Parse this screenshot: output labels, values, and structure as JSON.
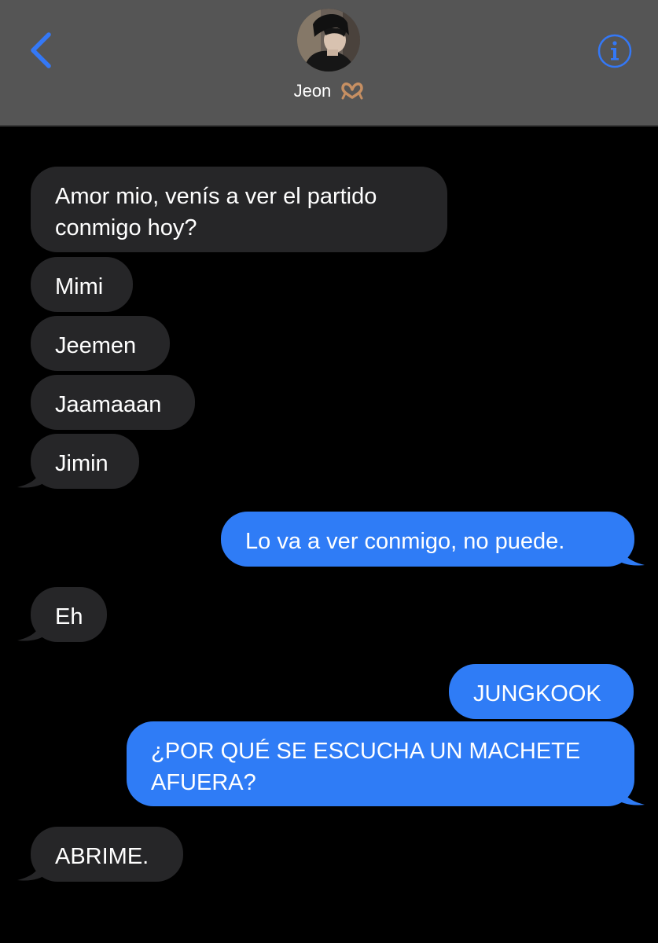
{
  "header": {
    "back_icon": "chevron-left-icon",
    "contact_name": "Jeon",
    "contact_emoji": "🫶🏽",
    "info_icon": "info-icon",
    "accent_color": "#3478f6",
    "background_color": "#555555"
  },
  "colors": {
    "received_bubble": "#262628",
    "sent_bubble": "#2f7cf6",
    "background": "#000000"
  },
  "messages": [
    {
      "sender": "contact",
      "text_lines": [
        "Amor mio, venís a ver el partido",
        "conmigo hoy?"
      ]
    },
    {
      "sender": "contact",
      "text_lines": [
        "Mimi"
      ]
    },
    {
      "sender": "contact",
      "text_lines": [
        "Jeemen"
      ]
    },
    {
      "sender": "contact",
      "text_lines": [
        "Jaamaaan"
      ]
    },
    {
      "sender": "contact",
      "text_lines": [
        "Jimin"
      ]
    },
    {
      "sender": "me",
      "text_lines": [
        "Lo va a ver conmigo, no puede."
      ]
    },
    {
      "sender": "contact",
      "text_lines": [
        "Eh"
      ]
    },
    {
      "sender": "me",
      "text_lines": [
        "JUNGKOOK"
      ]
    },
    {
      "sender": "me",
      "text_lines": [
        "¿POR QUÉ SE ESCUCHA UN MACHETE",
        "AFUERA?"
      ]
    },
    {
      "sender": "contact",
      "text_lines": [
        "ABRIME."
      ]
    }
  ]
}
